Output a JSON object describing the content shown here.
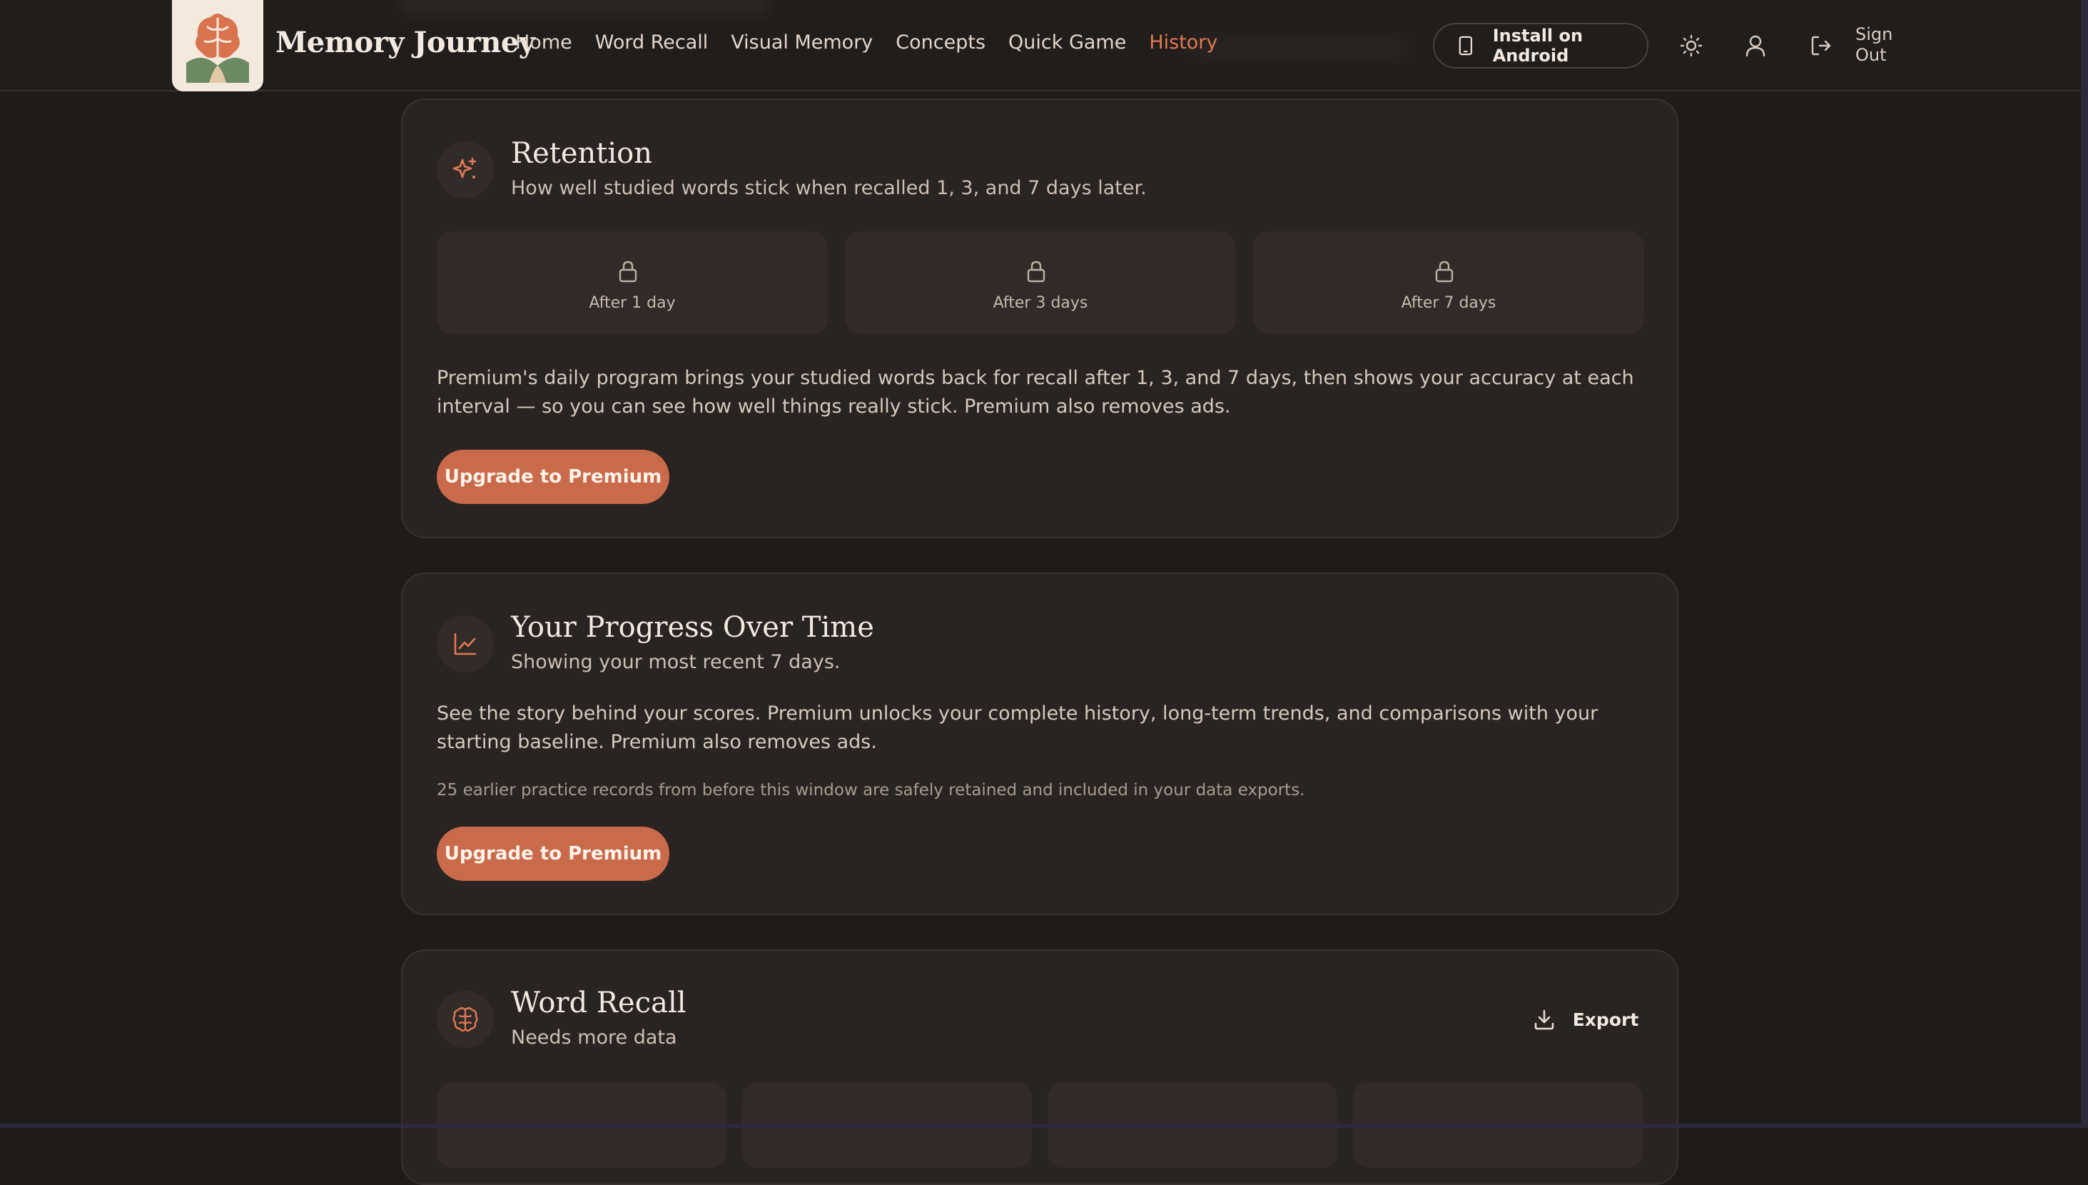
{
  "header": {
    "brand": "Memory Journey",
    "nav": [
      {
        "label": "Home",
        "active": false
      },
      {
        "label": "Word Recall",
        "active": false
      },
      {
        "label": "Visual Memory",
        "active": false
      },
      {
        "label": "Concepts",
        "active": false
      },
      {
        "label": "Quick Game",
        "active": false
      },
      {
        "label": "History",
        "active": true
      }
    ],
    "install_label": "Install on Android",
    "signout_label_line1": "Sign",
    "signout_label_line2": "Out",
    "icons": [
      "phone-icon",
      "sun-icon",
      "user-icon",
      "sign-out-icon",
      "brain-logo"
    ]
  },
  "retention": {
    "title": "Retention",
    "subtitle": "How well studied words stick when recalled 1, 3, and 7 days later.",
    "tiles": [
      "After 1 day",
      "After 3 days",
      "After 7 days"
    ],
    "body": "Premium's daily program brings your studied words back for recall after 1, 3, and 7 days, then shows your accuracy at each interval — so you can see how well things really stick. Premium also removes ads.",
    "button": "Upgrade to Premium",
    "icon": "sparkles-icon"
  },
  "progress": {
    "title": "Your Progress Over Time",
    "subtitle": "Showing your most recent 7 days.",
    "body": "See the story behind your scores. Premium unlocks your complete history, long-term trends, and comparisons with your starting baseline. Premium also removes ads.",
    "note": "25 earlier practice records from before this window are safely retained and included in your data exports.",
    "button": "Upgrade to Premium",
    "icon": "line-chart-icon"
  },
  "word_recall": {
    "title": "Word Recall",
    "subtitle": "Needs more data",
    "export_label": "Export",
    "icon": "brain-icon"
  },
  "colors": {
    "accent": "#e07a55",
    "button": "#c96b4b",
    "background": "#1f1b19",
    "card": "#292321"
  }
}
